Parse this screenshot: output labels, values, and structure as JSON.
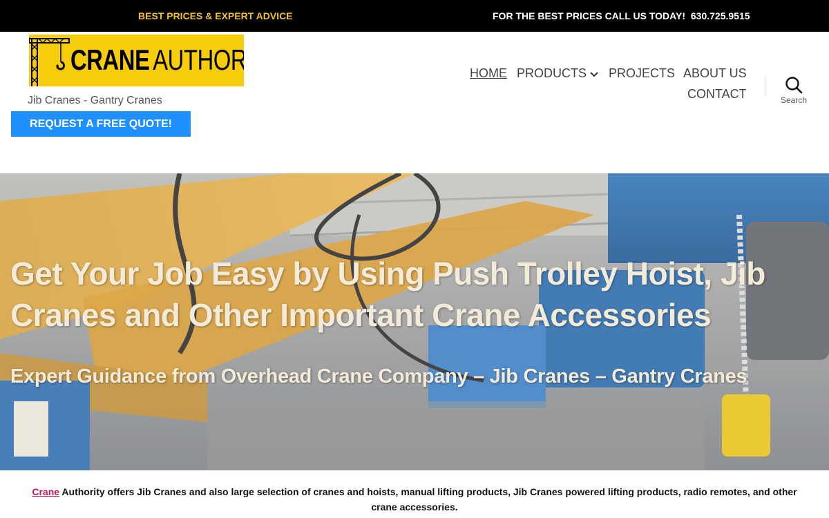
{
  "topbar": {
    "left_message": "BEST PRICES & EXPERT ADVICE",
    "right_message": "FOR THE BEST PRICES CALL US TODAY!",
    "phone": "630.725.9515"
  },
  "header": {
    "logo_word_1": "CRANE",
    "logo_word_2": "AUTHORITY",
    "tagline": "Jib Cranes - Gantry Cranes",
    "quote_button": "REQUEST A FREE QUOTE!",
    "search_label": "Search"
  },
  "nav": {
    "items": [
      {
        "label": "HOME"
      },
      {
        "label": "PRODUCTS"
      },
      {
        "label": "PROJECTS"
      },
      {
        "label": "ABOUT US"
      },
      {
        "label": "CONTACT"
      }
    ]
  },
  "hero": {
    "title": "Get Your Job Easy by Using Push Trolley Hoist, Jib Cranes and Other Important Crane Accessories",
    "subtitle": "Expert Guidance from Overhead Crane Company – Jib Cranes – Gantry Cranes"
  },
  "intro": {
    "link_text": "Crane",
    "text": "Authority offers Jib Cranes  and also large selection of cranes and hoists, manual lifting products, Jib Cranes powered lifting products, radio remotes, and other crane accessories."
  },
  "colors": {
    "topbar_bg": "#000000",
    "topbar_accent": "#f5c030",
    "logo_bg": "#f7cc0a",
    "quote_button_bg": "#1e90ff",
    "link_color": "#c2185b"
  },
  "icons": {
    "search": "search-icon",
    "products_dropdown": "chevron-down-icon",
    "logo_crane": "crane-icon"
  }
}
